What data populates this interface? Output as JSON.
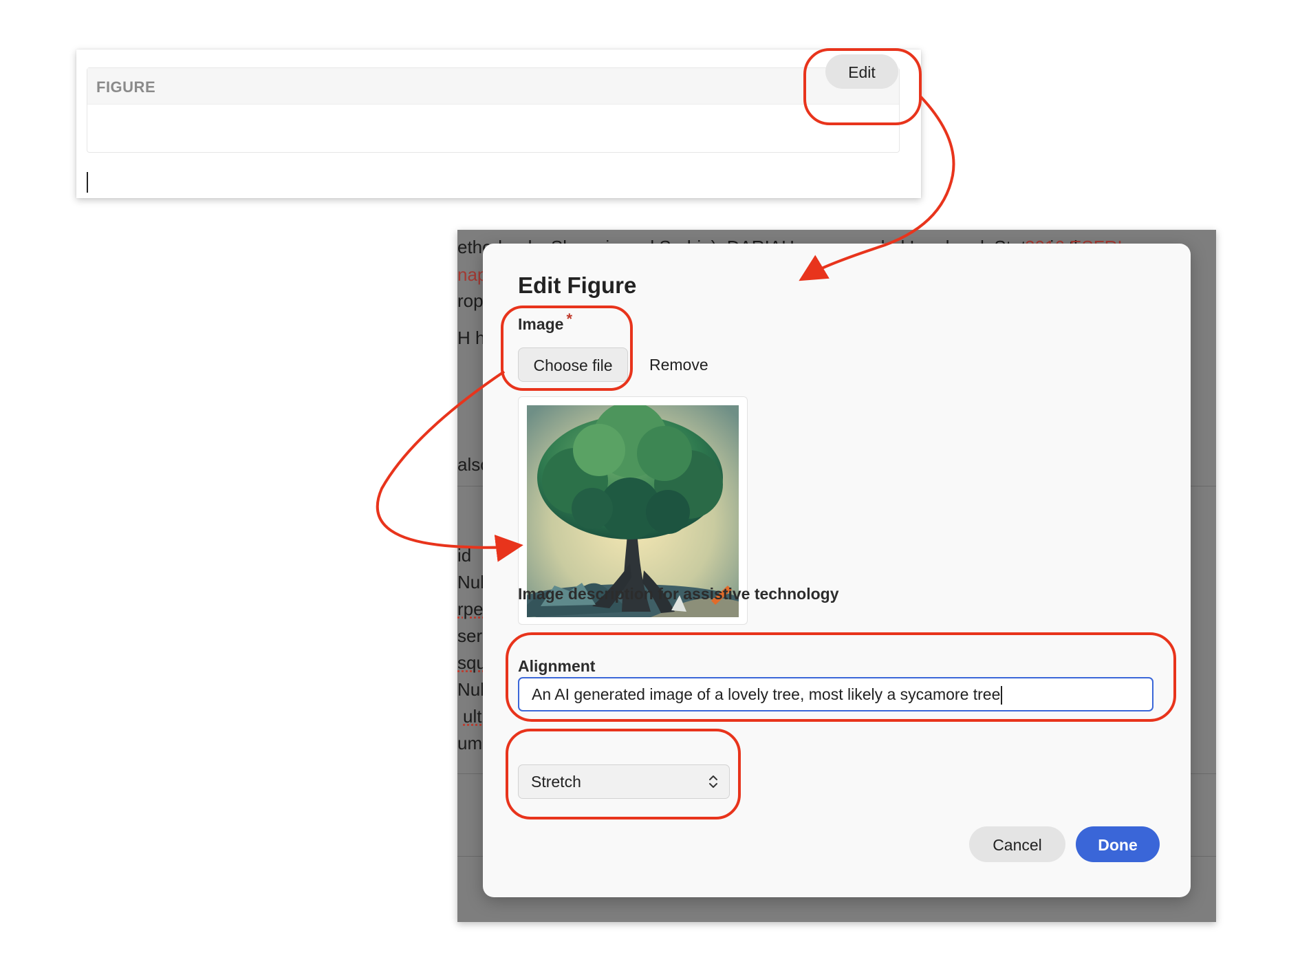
{
  "figure_block": {
    "label": "FIGURE",
    "edit_label": "Edit"
  },
  "background_text": {
    "lines": [
      "etherlands, Slovenia and Serbia). DARIAH was awarded Landmark Status in the",
      "2016 ESFRI",
      "nap",
      "rop",
      "H ha",
      "also",
      "id",
      "Nul",
      "rper",
      "ser",
      "squ",
      "Nul",
      "ult",
      "um"
    ]
  },
  "modal": {
    "title": "Edit Figure",
    "image": {
      "label": "Image",
      "required_mark": "*",
      "choose_label": "Choose file",
      "remove_label": "Remove",
      "preview_alt": "An AI generated image of a lovely tree, most likely a sycamore tree"
    },
    "description": {
      "label": "Image description for assistive technology",
      "value": "An AI generated image of a lovely tree, most likely a sycamore tree"
    },
    "alignment": {
      "label": "Alignment",
      "selected": "Stretch"
    },
    "actions": {
      "cancel_label": "Cancel",
      "done_label": "Done"
    }
  },
  "colors": {
    "annotation": "#e8341c",
    "accent": "#3a66d8",
    "required": "#c0392b"
  }
}
